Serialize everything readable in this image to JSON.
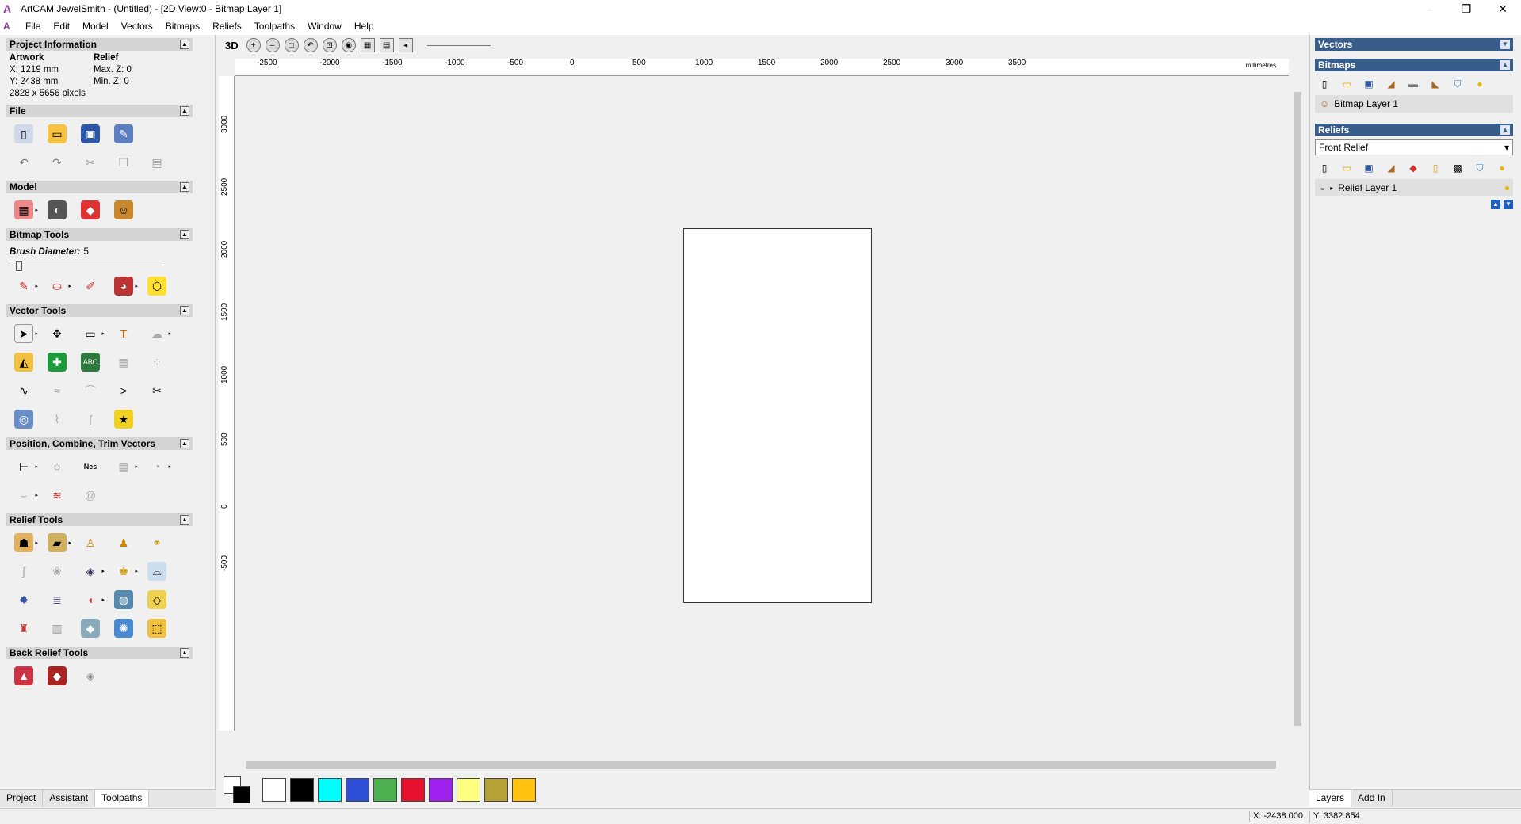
{
  "window": {
    "title": "ArtCAM JewelSmith - (Untitled) - [2D View:0 - Bitmap Layer 1]",
    "controls": [
      "–",
      "❐",
      "✕"
    ]
  },
  "menubar": {
    "items": [
      "File",
      "Edit",
      "Model",
      "Vectors",
      "Bitmaps",
      "Reliefs",
      "Toolpaths",
      "Window",
      "Help"
    ]
  },
  "left": {
    "project_info": {
      "header": "Project Information",
      "artwork_label": "Artwork",
      "relief_label": "Relief",
      "x": "X: 1219 mm",
      "max_z": "Max. Z: 0",
      "y": "Y: 2438 mm",
      "min_z": "Min. Z: 0",
      "pixels": "2828 x 5656 pixels"
    },
    "file_header": "File",
    "model_header": "Model",
    "bitmap_tools_header": "Bitmap Tools",
    "brush_label": "Brush Diameter:",
    "brush_value": "5",
    "brush_level": 0.03,
    "vector_tools_header": "Vector Tools",
    "position_header": "Position, Combine, Trim Vectors",
    "relief_tools_header": "Relief Tools",
    "back_relief_header": "Back Relief Tools",
    "tabs": [
      "Project",
      "Assistant",
      "Toolpaths"
    ]
  },
  "view": {
    "mode_3d": "3D",
    "ruler_unit": "millimetres",
    "h_ticks": [
      "-2500",
      "-2000",
      "-1500",
      "-1000",
      "-500",
      "0",
      "500",
      "1000",
      "1500",
      "2000",
      "2500",
      "3000",
      "3500"
    ],
    "v_ticks": [
      "3000",
      "2500",
      "2000",
      "1500",
      "1000",
      "500",
      "0",
      "-500"
    ]
  },
  "palette": {
    "colors": [
      "#ffffff",
      "#000000",
      "#00ffff",
      "#2f4fd8",
      "#4caf50",
      "#e8112d",
      "#a020f0",
      "#ffff80",
      "#b5a135",
      "#ffc20e"
    ]
  },
  "right": {
    "vectors_header": "Vectors",
    "bitmaps_header": "Bitmaps",
    "bitmap_layer": "Bitmap Layer 1",
    "reliefs_header": "Reliefs",
    "relief_select": "Front Relief",
    "relief_layer": "Relief Layer 1",
    "tabs": [
      "Layers",
      "Add In"
    ]
  },
  "status": {
    "x": "X: -2438.000",
    "y": "Y: 3382.854"
  }
}
